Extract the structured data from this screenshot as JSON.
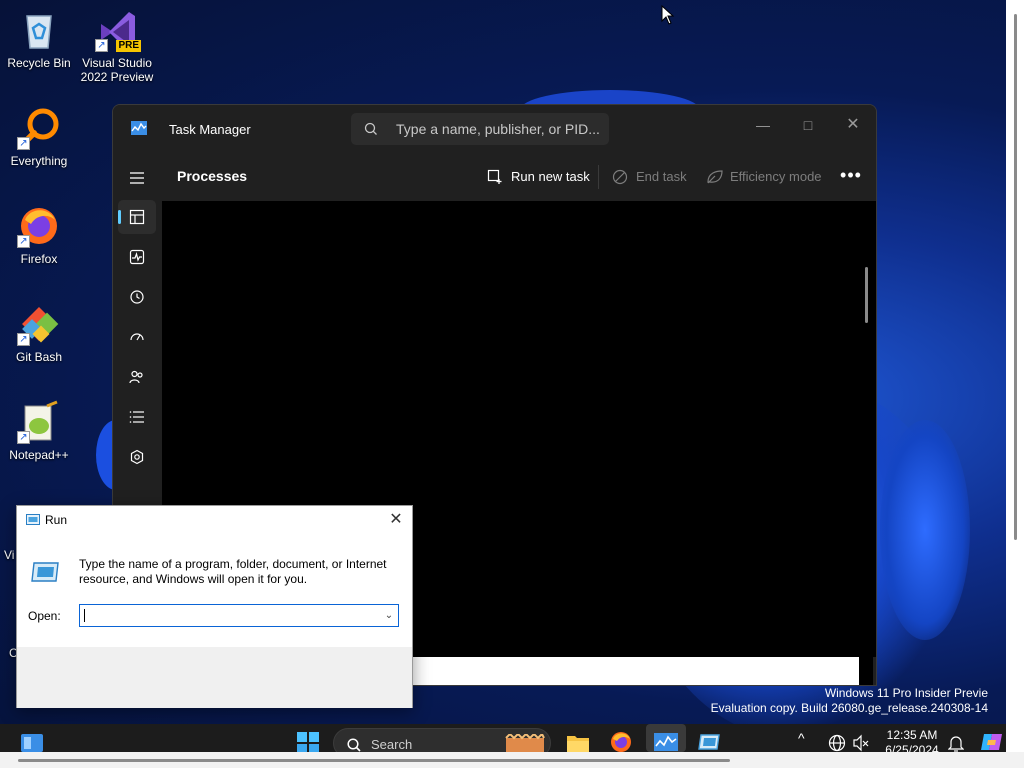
{
  "desktop": {
    "icons": [
      {
        "label": "Recycle Bin",
        "icon": "recycle-bin-icon"
      },
      {
        "label": "Visual Studio 2022 Preview",
        "icon": "visual-studio-icon",
        "badge": "PRE"
      },
      {
        "label": "Everything",
        "icon": "everything-search-icon"
      },
      {
        "label": "Firefox",
        "icon": "firefox-icon"
      },
      {
        "label": "Git Bash",
        "icon": "git-bash-icon"
      },
      {
        "label": "Notepad++",
        "icon": "notepadpp-icon"
      }
    ],
    "partial_labels": [
      "Vi",
      "C"
    ]
  },
  "task_manager": {
    "title": "Task Manager",
    "search_placeholder": "Type a name, publisher, or PID...",
    "page_title": "Processes",
    "commands": {
      "run_new_task": "Run new task",
      "end_task": "End task",
      "efficiency_mode": "Efficiency mode",
      "more": "•••"
    },
    "nav": [
      "processes-icon",
      "performance-icon",
      "app-history-icon",
      "startup-apps-icon",
      "users-icon",
      "details-icon",
      "services-icon"
    ],
    "accent": "#60cdff"
  },
  "run_dialog": {
    "title": "Run",
    "description": "Type the name of a program, folder, document, or Internet resource, and Windows will open it for you.",
    "open_label": "Open:",
    "open_value": ""
  },
  "watermark": {
    "line1": "Windows 11 Pro Insider Previe",
    "line2": "Evaluation copy. Build 26080.ge_release.240308-14"
  },
  "taskbar": {
    "search_label": "Search",
    "time": "12:35 AM",
    "date": "6/25/2024",
    "tray_overflow": "^"
  }
}
